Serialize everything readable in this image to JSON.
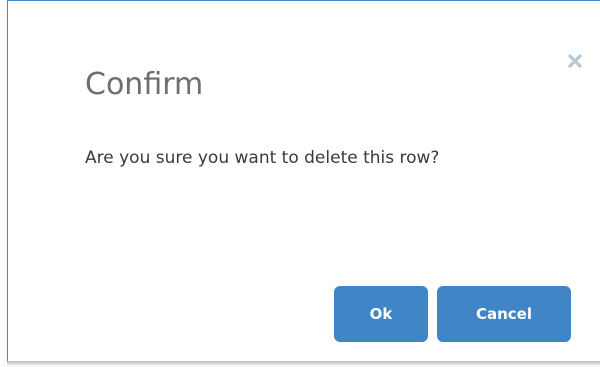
{
  "dialog": {
    "title": "Confirm",
    "message": "Are you sure you want to delete this row?",
    "close_icon": "close-icon",
    "buttons": {
      "ok_label": "Ok",
      "cancel_label": "Cancel"
    }
  },
  "colors": {
    "accent": "#4086c6",
    "border": "#3c8ccd",
    "title_text": "#6e6e6e",
    "close_icon": "#b9c6d3"
  }
}
